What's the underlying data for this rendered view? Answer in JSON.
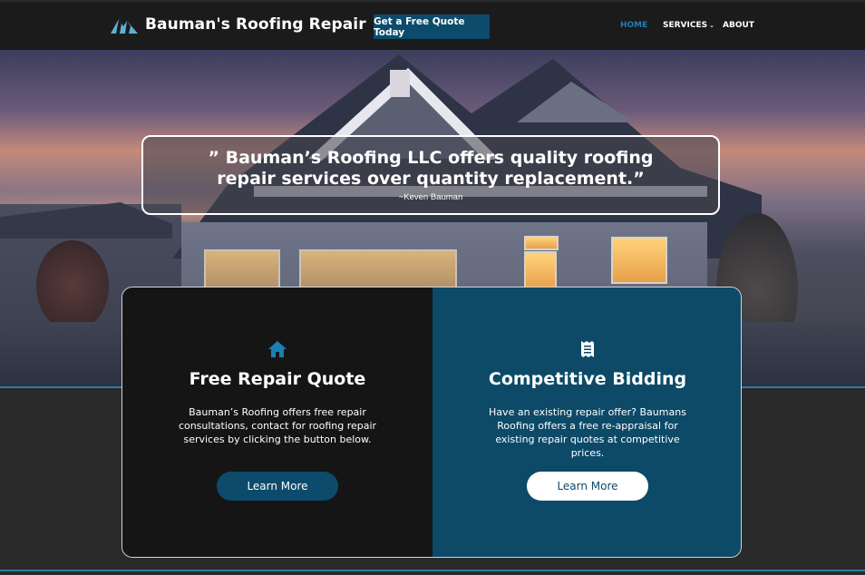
{
  "header": {
    "brand_name": "Bauman's Roofing Repair",
    "brand_icon": "mountain-logo-icon",
    "cta_label": "Get a Free Quote Today",
    "nav": [
      {
        "label": "HOME",
        "active": true
      },
      {
        "label": "SERVICES",
        "has_dropdown": true
      },
      {
        "label": "ABOUT"
      }
    ]
  },
  "hero": {
    "quote": "” Bauman’s Roofing LLC offers quality roofing repair services over quantity replacement.”",
    "author": "~Keven Bauman"
  },
  "cards": {
    "left": {
      "icon": "home-icon",
      "title": "Free Repair Quote",
      "text": "Bauman’s Roofing offers free repair consultations, contact for roofing repair services by clicking the button below.",
      "button": "Learn More"
    },
    "right": {
      "icon": "receipt-icon",
      "title": "Competitive Bidding",
      "text": "Have an existing repair offer? Baumans Roofing offers a free re-appraisal for existing repair quotes at competitive prices.",
      "button": "Learn More"
    }
  },
  "colors": {
    "accent": "#0c4b6b",
    "active_nav": "#1d7fb3",
    "header_bg": "#1b1b1b",
    "card_dark": "#151515"
  }
}
